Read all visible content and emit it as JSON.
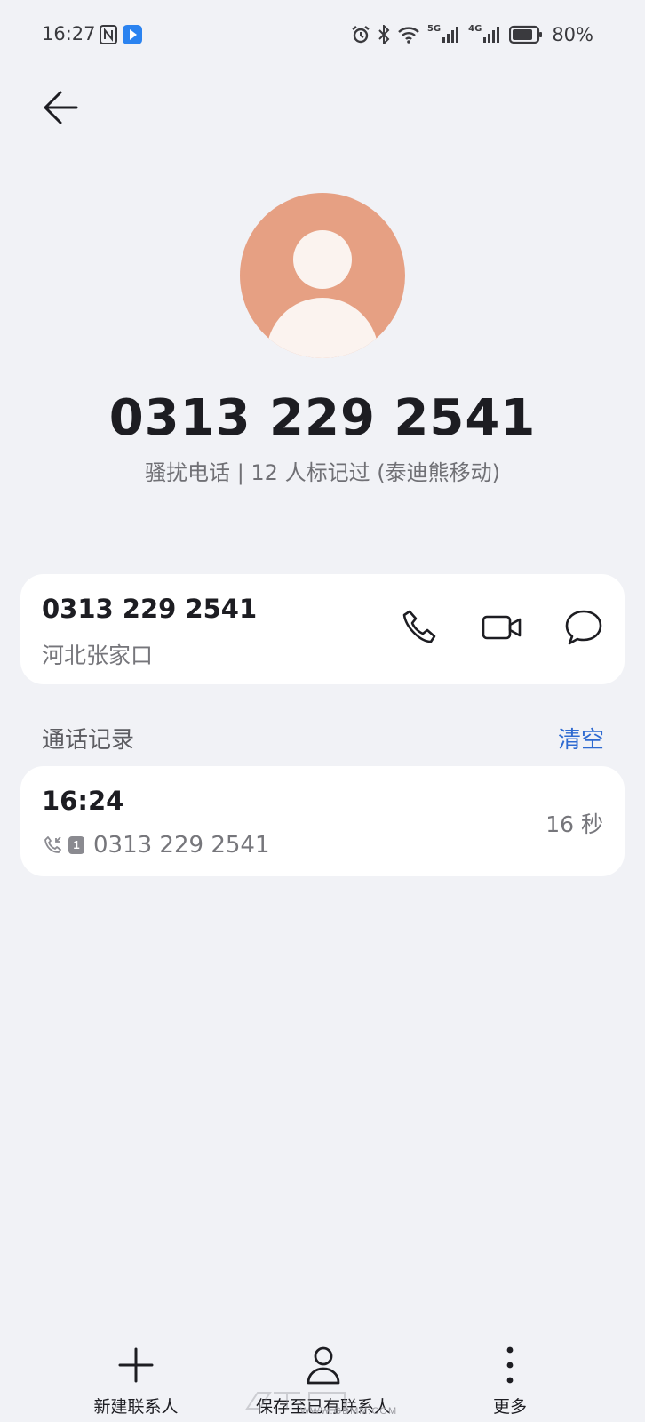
{
  "status_bar": {
    "time": "16:27",
    "battery": "80%",
    "icons": [
      "nfc-icon",
      "app-notification-icon",
      "alarm-icon",
      "bluetooth-icon",
      "wifi-icon",
      "signal-5g-icon",
      "signal-4g-icon",
      "battery-icon"
    ],
    "network_5g": "5G",
    "network_4g": "4G"
  },
  "header": {
    "back_icon": "arrow-left-icon"
  },
  "contact": {
    "avatar_icon": "person-placeholder-icon",
    "avatar_color": "#e6a083",
    "number": "0313 229 2541",
    "tag": "骚扰电话 | 12 人标记过 (泰迪熊移动)"
  },
  "number_card": {
    "number": "0313 229 2541",
    "location": "河北张家口",
    "actions": [
      {
        "icon": "phone-call-icon"
      },
      {
        "icon": "video-call-icon"
      },
      {
        "icon": "message-icon"
      }
    ]
  },
  "call_log": {
    "title": "通话记录",
    "clear_label": "清空",
    "clear_color": "#2e6ad1",
    "entries": [
      {
        "time": "16:24",
        "type_icon": "incoming-call-icon",
        "sim": "1",
        "number": "0313 229 2541",
        "duration": "16 秒"
      }
    ]
  },
  "bottom_bar": {
    "new_contact": "新建联系人",
    "save_existing": "保存至已有联系人",
    "more": "更多"
  },
  "watermark": {
    "text": "WWW.GDMM.COM"
  }
}
